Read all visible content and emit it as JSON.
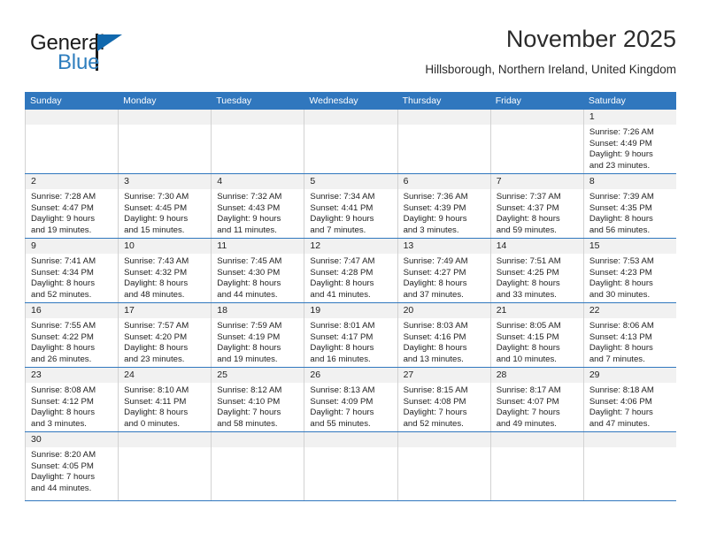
{
  "brand": {
    "name_top": "General",
    "name_bottom": "Blue",
    "accent_color": "#2e7ebe",
    "triangle_color": "#1168ad"
  },
  "header": {
    "title": "November 2025",
    "subtitle": "Hillsborough, Northern Ireland, United Kingdom"
  },
  "calendar": {
    "header_color": "#3077be",
    "row_border_color": "#3077be",
    "daynum_band_color": "#f1f1f1",
    "weekdays": [
      "Sunday",
      "Monday",
      "Tuesday",
      "Wednesday",
      "Thursday",
      "Friday",
      "Saturday"
    ],
    "weeks": [
      [
        {
          "day": "",
          "empty": true
        },
        {
          "day": "",
          "empty": true
        },
        {
          "day": "",
          "empty": true
        },
        {
          "day": "",
          "empty": true
        },
        {
          "day": "",
          "empty": true
        },
        {
          "day": "",
          "empty": true
        },
        {
          "day": "1",
          "sunrise": "Sunrise: 7:26 AM",
          "sunset": "Sunset: 4:49 PM",
          "daylight1": "Daylight: 9 hours",
          "daylight2": "and 23 minutes."
        }
      ],
      [
        {
          "day": "2",
          "sunrise": "Sunrise: 7:28 AM",
          "sunset": "Sunset: 4:47 PM",
          "daylight1": "Daylight: 9 hours",
          "daylight2": "and 19 minutes."
        },
        {
          "day": "3",
          "sunrise": "Sunrise: 7:30 AM",
          "sunset": "Sunset: 4:45 PM",
          "daylight1": "Daylight: 9 hours",
          "daylight2": "and 15 minutes."
        },
        {
          "day": "4",
          "sunrise": "Sunrise: 7:32 AM",
          "sunset": "Sunset: 4:43 PM",
          "daylight1": "Daylight: 9 hours",
          "daylight2": "and 11 minutes."
        },
        {
          "day": "5",
          "sunrise": "Sunrise: 7:34 AM",
          "sunset": "Sunset: 4:41 PM",
          "daylight1": "Daylight: 9 hours",
          "daylight2": "and 7 minutes."
        },
        {
          "day": "6",
          "sunrise": "Sunrise: 7:36 AM",
          "sunset": "Sunset: 4:39 PM",
          "daylight1": "Daylight: 9 hours",
          "daylight2": "and 3 minutes."
        },
        {
          "day": "7",
          "sunrise": "Sunrise: 7:37 AM",
          "sunset": "Sunset: 4:37 PM",
          "daylight1": "Daylight: 8 hours",
          "daylight2": "and 59 minutes."
        },
        {
          "day": "8",
          "sunrise": "Sunrise: 7:39 AM",
          "sunset": "Sunset: 4:35 PM",
          "daylight1": "Daylight: 8 hours",
          "daylight2": "and 56 minutes."
        }
      ],
      [
        {
          "day": "9",
          "sunrise": "Sunrise: 7:41 AM",
          "sunset": "Sunset: 4:34 PM",
          "daylight1": "Daylight: 8 hours",
          "daylight2": "and 52 minutes."
        },
        {
          "day": "10",
          "sunrise": "Sunrise: 7:43 AM",
          "sunset": "Sunset: 4:32 PM",
          "daylight1": "Daylight: 8 hours",
          "daylight2": "and 48 minutes."
        },
        {
          "day": "11",
          "sunrise": "Sunrise: 7:45 AM",
          "sunset": "Sunset: 4:30 PM",
          "daylight1": "Daylight: 8 hours",
          "daylight2": "and 44 minutes."
        },
        {
          "day": "12",
          "sunrise": "Sunrise: 7:47 AM",
          "sunset": "Sunset: 4:28 PM",
          "daylight1": "Daylight: 8 hours",
          "daylight2": "and 41 minutes."
        },
        {
          "day": "13",
          "sunrise": "Sunrise: 7:49 AM",
          "sunset": "Sunset: 4:27 PM",
          "daylight1": "Daylight: 8 hours",
          "daylight2": "and 37 minutes."
        },
        {
          "day": "14",
          "sunrise": "Sunrise: 7:51 AM",
          "sunset": "Sunset: 4:25 PM",
          "daylight1": "Daylight: 8 hours",
          "daylight2": "and 33 minutes."
        },
        {
          "day": "15",
          "sunrise": "Sunrise: 7:53 AM",
          "sunset": "Sunset: 4:23 PM",
          "daylight1": "Daylight: 8 hours",
          "daylight2": "and 30 minutes."
        }
      ],
      [
        {
          "day": "16",
          "sunrise": "Sunrise: 7:55 AM",
          "sunset": "Sunset: 4:22 PM",
          "daylight1": "Daylight: 8 hours",
          "daylight2": "and 26 minutes."
        },
        {
          "day": "17",
          "sunrise": "Sunrise: 7:57 AM",
          "sunset": "Sunset: 4:20 PM",
          "daylight1": "Daylight: 8 hours",
          "daylight2": "and 23 minutes."
        },
        {
          "day": "18",
          "sunrise": "Sunrise: 7:59 AM",
          "sunset": "Sunset: 4:19 PM",
          "daylight1": "Daylight: 8 hours",
          "daylight2": "and 19 minutes."
        },
        {
          "day": "19",
          "sunrise": "Sunrise: 8:01 AM",
          "sunset": "Sunset: 4:17 PM",
          "daylight1": "Daylight: 8 hours",
          "daylight2": "and 16 minutes."
        },
        {
          "day": "20",
          "sunrise": "Sunrise: 8:03 AM",
          "sunset": "Sunset: 4:16 PM",
          "daylight1": "Daylight: 8 hours",
          "daylight2": "and 13 minutes."
        },
        {
          "day": "21",
          "sunrise": "Sunrise: 8:05 AM",
          "sunset": "Sunset: 4:15 PM",
          "daylight1": "Daylight: 8 hours",
          "daylight2": "and 10 minutes."
        },
        {
          "day": "22",
          "sunrise": "Sunrise: 8:06 AM",
          "sunset": "Sunset: 4:13 PM",
          "daylight1": "Daylight: 8 hours",
          "daylight2": "and 7 minutes."
        }
      ],
      [
        {
          "day": "23",
          "sunrise": "Sunrise: 8:08 AM",
          "sunset": "Sunset: 4:12 PM",
          "daylight1": "Daylight: 8 hours",
          "daylight2": "and 3 minutes."
        },
        {
          "day": "24",
          "sunrise": "Sunrise: 8:10 AM",
          "sunset": "Sunset: 4:11 PM",
          "daylight1": "Daylight: 8 hours",
          "daylight2": "and 0 minutes."
        },
        {
          "day": "25",
          "sunrise": "Sunrise: 8:12 AM",
          "sunset": "Sunset: 4:10 PM",
          "daylight1": "Daylight: 7 hours",
          "daylight2": "and 58 minutes."
        },
        {
          "day": "26",
          "sunrise": "Sunrise: 8:13 AM",
          "sunset": "Sunset: 4:09 PM",
          "daylight1": "Daylight: 7 hours",
          "daylight2": "and 55 minutes."
        },
        {
          "day": "27",
          "sunrise": "Sunrise: 8:15 AM",
          "sunset": "Sunset: 4:08 PM",
          "daylight1": "Daylight: 7 hours",
          "daylight2": "and 52 minutes."
        },
        {
          "day": "28",
          "sunrise": "Sunrise: 8:17 AM",
          "sunset": "Sunset: 4:07 PM",
          "daylight1": "Daylight: 7 hours",
          "daylight2": "and 49 minutes."
        },
        {
          "day": "29",
          "sunrise": "Sunrise: 8:18 AM",
          "sunset": "Sunset: 4:06 PM",
          "daylight1": "Daylight: 7 hours",
          "daylight2": "and 47 minutes."
        }
      ],
      [
        {
          "day": "30",
          "sunrise": "Sunrise: 8:20 AM",
          "sunset": "Sunset: 4:05 PM",
          "daylight1": "Daylight: 7 hours",
          "daylight2": "and 44 minutes."
        },
        {
          "day": "",
          "empty": true
        },
        {
          "day": "",
          "empty": true
        },
        {
          "day": "",
          "empty": true
        },
        {
          "day": "",
          "empty": true
        },
        {
          "day": "",
          "empty": true
        },
        {
          "day": "",
          "empty": true
        }
      ]
    ]
  }
}
